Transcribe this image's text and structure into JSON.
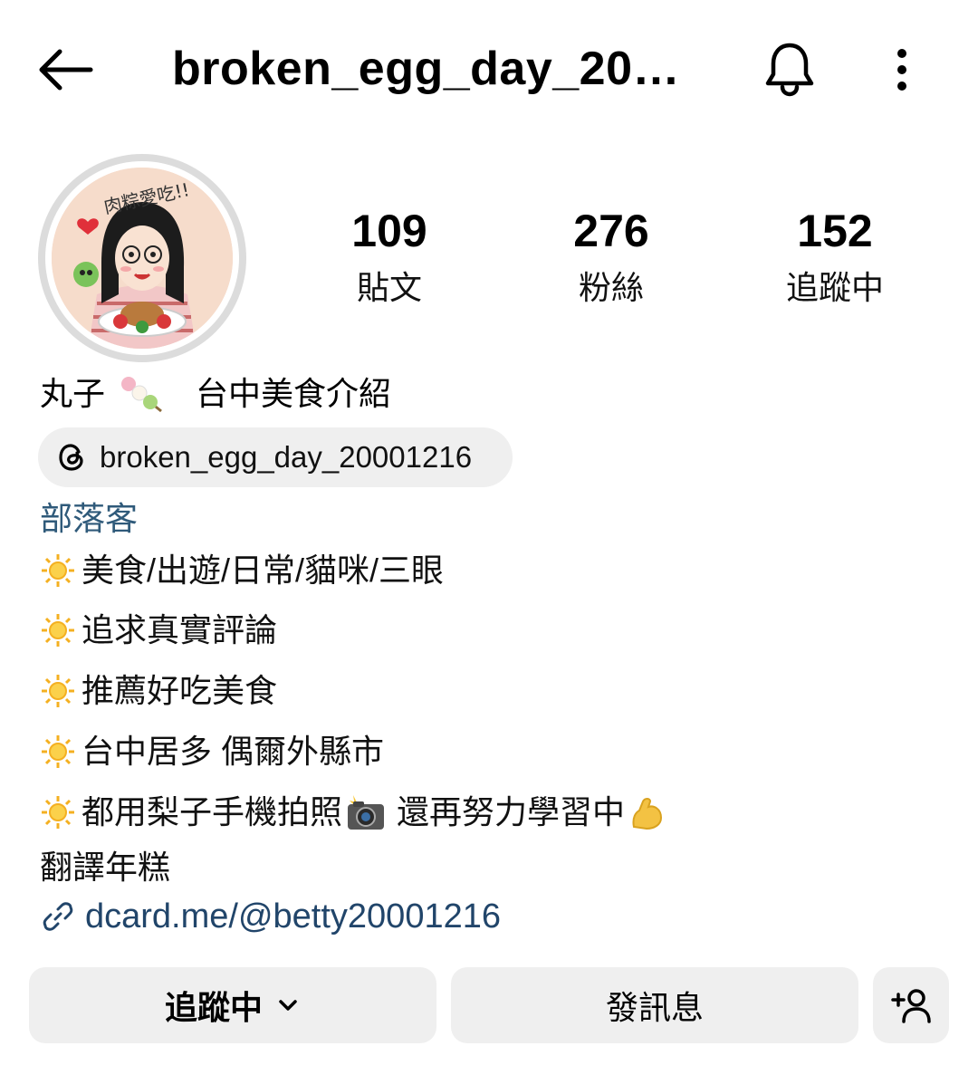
{
  "header": {
    "title": "broken_egg_day_20…"
  },
  "profile": {
    "stats": [
      {
        "value": "109",
        "label": "貼文"
      },
      {
        "value": "276",
        "label": "粉絲"
      },
      {
        "value": "152",
        "label": "追蹤中"
      }
    ],
    "name": "丸子",
    "name_suffix": "台中美食介紹",
    "threads_handle": "broken_egg_day_20001216",
    "category": "部落客",
    "bio": [
      "美食/出遊/日常/貓咪/三眼",
      "追求真實評論",
      "推薦好吃美食",
      "台中居多 偶爾外縣市",
      "都用梨子手機拍照",
      "還再努力學習中"
    ],
    "bio_extra": "翻譯年糕",
    "link": "dcard.me/@betty20001216",
    "avatar_text": "肉粽愛吃!!"
  },
  "actions": {
    "following_label": "追蹤中",
    "message_label": "發訊息"
  },
  "icons": [
    "back-arrow-icon",
    "bell-icon",
    "more-vertical-icon",
    "threads-icon",
    "link-icon",
    "chevron-down-icon",
    "add-user-icon",
    "sun-emoji",
    "dango-emoji",
    "camera-flash-emoji",
    "flexed-biceps-emoji"
  ],
  "colors": {
    "category": "#2f5a7a",
    "link": "#21456a",
    "button_bg": "#efefef",
    "chip_bg": "#efefef"
  }
}
